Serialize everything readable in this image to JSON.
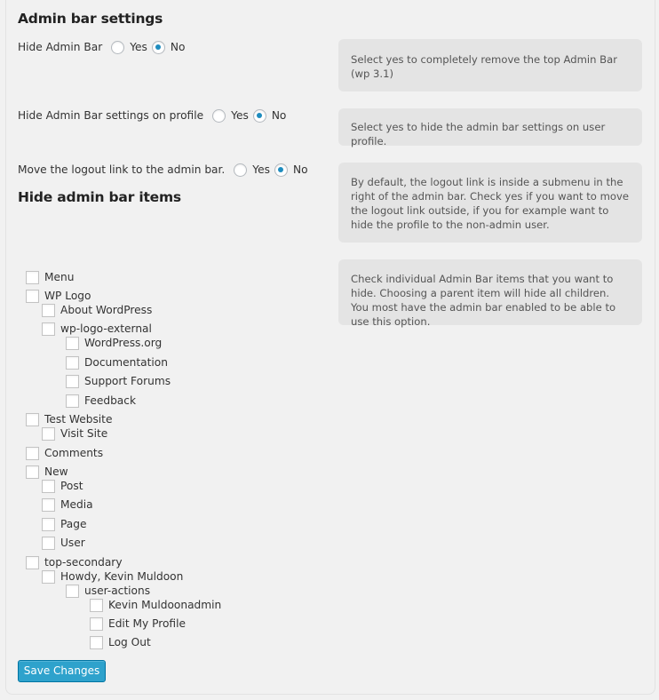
{
  "page": {
    "section1_title": "Admin bar settings",
    "section2_title": "Hide admin bar items",
    "accent_color": "#2ea2cc"
  },
  "settings": [
    {
      "label": "Hide Admin Bar",
      "options": [
        "Yes",
        "No"
      ],
      "selected": "No",
      "help": "Select yes to completely remove the top Admin Bar (wp 3.1)"
    },
    {
      "label": "Hide Admin Bar settings on profile",
      "options": [
        "Yes",
        "No"
      ],
      "selected": "No",
      "help": "Select yes to hide the admin bar settings on user profile."
    },
    {
      "label": "Move the logout link to the admin bar.",
      "options": [
        "Yes",
        "No"
      ],
      "selected": "No",
      "help": "By default, the logout link is inside a submenu in the right of the admin bar. Check yes if you want to move the logout link outside, if you for example want to hide the profile to the non-admin user."
    }
  ],
  "items_help": "Check individual Admin Bar items that you want to hide. Choosing a parent item will hide all children. You most have the admin bar enabled to be able to use this option.",
  "items": [
    {
      "label": "Menu",
      "level": 0,
      "checked": false
    },
    {
      "label": "WP Logo",
      "level": 0,
      "checked": false
    },
    {
      "label": "About WordPress",
      "level": 1,
      "checked": false
    },
    {
      "label": "wp-logo-external",
      "level": 1,
      "checked": false
    },
    {
      "label": "WordPress.org",
      "level": 2,
      "checked": false
    },
    {
      "label": "Documentation",
      "level": 2,
      "checked": false
    },
    {
      "label": "Support Forums",
      "level": 2,
      "checked": false
    },
    {
      "label": "Feedback",
      "level": 2,
      "checked": false
    },
    {
      "label": "Test Website",
      "level": 0,
      "checked": false
    },
    {
      "label": "Visit Site",
      "level": 1,
      "checked": false
    },
    {
      "label": "Comments",
      "level": 0,
      "checked": false
    },
    {
      "label": "New",
      "level": 0,
      "checked": false
    },
    {
      "label": "Post",
      "level": 1,
      "checked": false
    },
    {
      "label": "Media",
      "level": 1,
      "checked": false
    },
    {
      "label": "Page",
      "level": 1,
      "checked": false
    },
    {
      "label": "User",
      "level": 1,
      "checked": false
    },
    {
      "label": "top-secondary",
      "level": 0,
      "checked": false
    },
    {
      "label": "Howdy, Kevin Muldoon",
      "level": 1,
      "checked": false
    },
    {
      "label": "user-actions",
      "level": 2,
      "checked": false
    },
    {
      "label": "Kevin Muldoonadmin",
      "level": 3,
      "checked": false
    },
    {
      "label": "Edit My Profile",
      "level": 3,
      "checked": false
    },
    {
      "label": "Log Out",
      "level": 3,
      "checked": false
    }
  ],
  "save_label": "Save Changes"
}
